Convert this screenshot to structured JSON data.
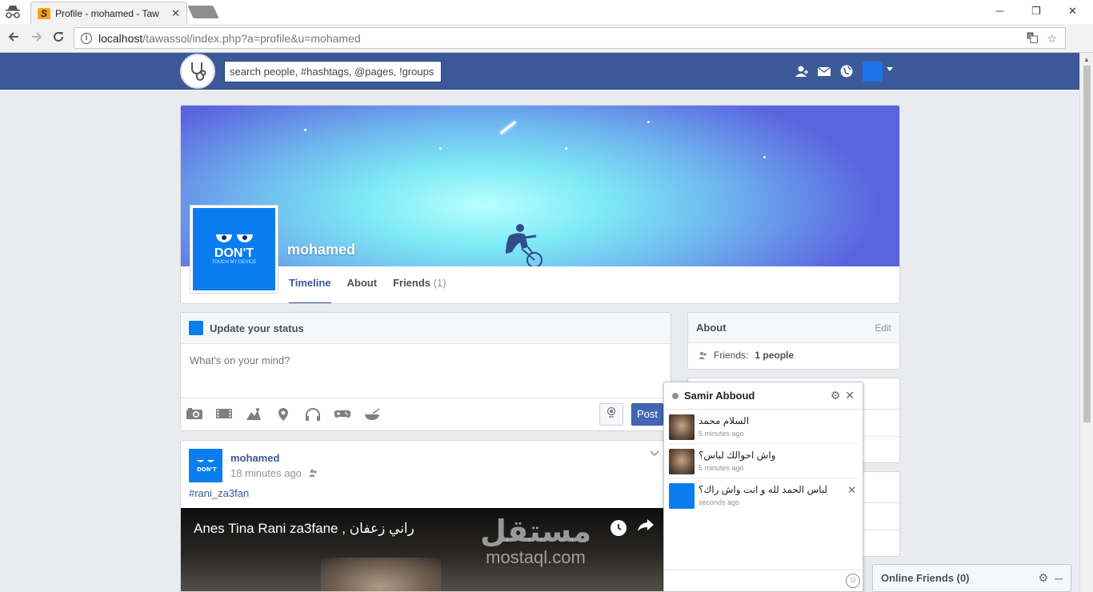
{
  "browser": {
    "tab_title": "Profile - mohamed - Taw",
    "favicon_letter": "S",
    "url_host": "localhost",
    "url_path": "/tawassol/index.php?a=profile&u=mohamed",
    "close_glyph": "✕",
    "minimize_glyph": "─",
    "restore_glyph": "❐",
    "window_close_glyph": "✕"
  },
  "header": {
    "search_placeholder": "search people, #hashtags, @pages, !groups",
    "icons": [
      "friends-icon",
      "messages-icon",
      "notifications-globe-icon"
    ],
    "brand_color": "#3b5998"
  },
  "profile": {
    "name": "mohamed",
    "avatar_text": "DON'T",
    "avatar_subtext": "TOUCH MY DEVICE",
    "tabs": [
      {
        "label": "Timeline",
        "active": true
      },
      {
        "label": "About",
        "active": false
      },
      {
        "label": "Friends",
        "count": "(1)",
        "active": false
      }
    ]
  },
  "status": {
    "title": "Update your status",
    "placeholder": "What's on your mind?",
    "post_label": "Post",
    "tools": [
      "camera-icon",
      "video-icon",
      "activity-icon",
      "location-icon",
      "music-icon",
      "game-icon",
      "food-icon"
    ]
  },
  "post": {
    "author": "mohamed",
    "time": "18 minutes ago",
    "hashtag": "#rani_za3fan",
    "video_title": "Anes Tina Rani za3fane , راني زعفان",
    "watermark_ar": "مستقل",
    "watermark_en": "mostaql.com"
  },
  "about": {
    "title": "About",
    "edit_label": "Edit",
    "friends_label": "Friends:",
    "friends_value": "1 people"
  },
  "chat": {
    "name": "Samir Abboud",
    "messages": [
      {
        "text": "السلام محمد",
        "time": "5 minutes ago",
        "mine": false
      },
      {
        "text": "واش احوالك لباس؟",
        "time": "5 minutes ago",
        "mine": false
      },
      {
        "text": "لباس الحمد لله و انت واش راك؟",
        "time": "seconds ago",
        "mine": true
      }
    ]
  },
  "online_friends": {
    "label": "Online Friends (0)"
  }
}
